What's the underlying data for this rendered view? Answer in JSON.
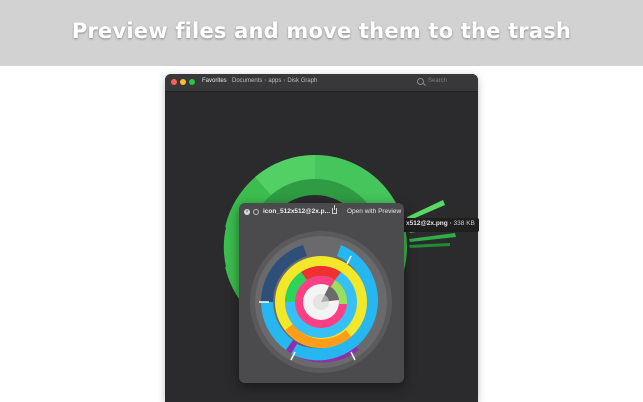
{
  "banner": {
    "title": "Preview files and move them to the trash",
    "background": "#d2d2d2"
  },
  "window": {
    "favorites_label": "Favorites",
    "breadcrumb": [
      "Documents",
      "apps",
      "Disk Graph"
    ],
    "breadcrumb_separator": "›",
    "search_placeholder": "Search",
    "background": "#2b2b2d"
  },
  "disk_graph": {
    "colors": [
      "#3fbd52",
      "#4fd05e",
      "#43b85a",
      "#1e8a2f",
      "#6fd96f"
    ],
    "hovered_item": {
      "name": "x512@2x.png",
      "size": "338 KB"
    }
  },
  "quick_look": {
    "filename": "icon_512x512@2x.p...",
    "open_with_label": "Open with Preview",
    "close_icon": "close-icon",
    "expand_icon": "expand-icon",
    "share_icon": "share-icon",
    "icon_ring_colors": [
      "#8f2ea8",
      "#27b7f0",
      "#f2e829",
      "#ff9c1a",
      "#36c0f5",
      "#ff3f84",
      "#2dd35a",
      "#f23030",
      "#ffd24a",
      "#ffffff"
    ]
  }
}
